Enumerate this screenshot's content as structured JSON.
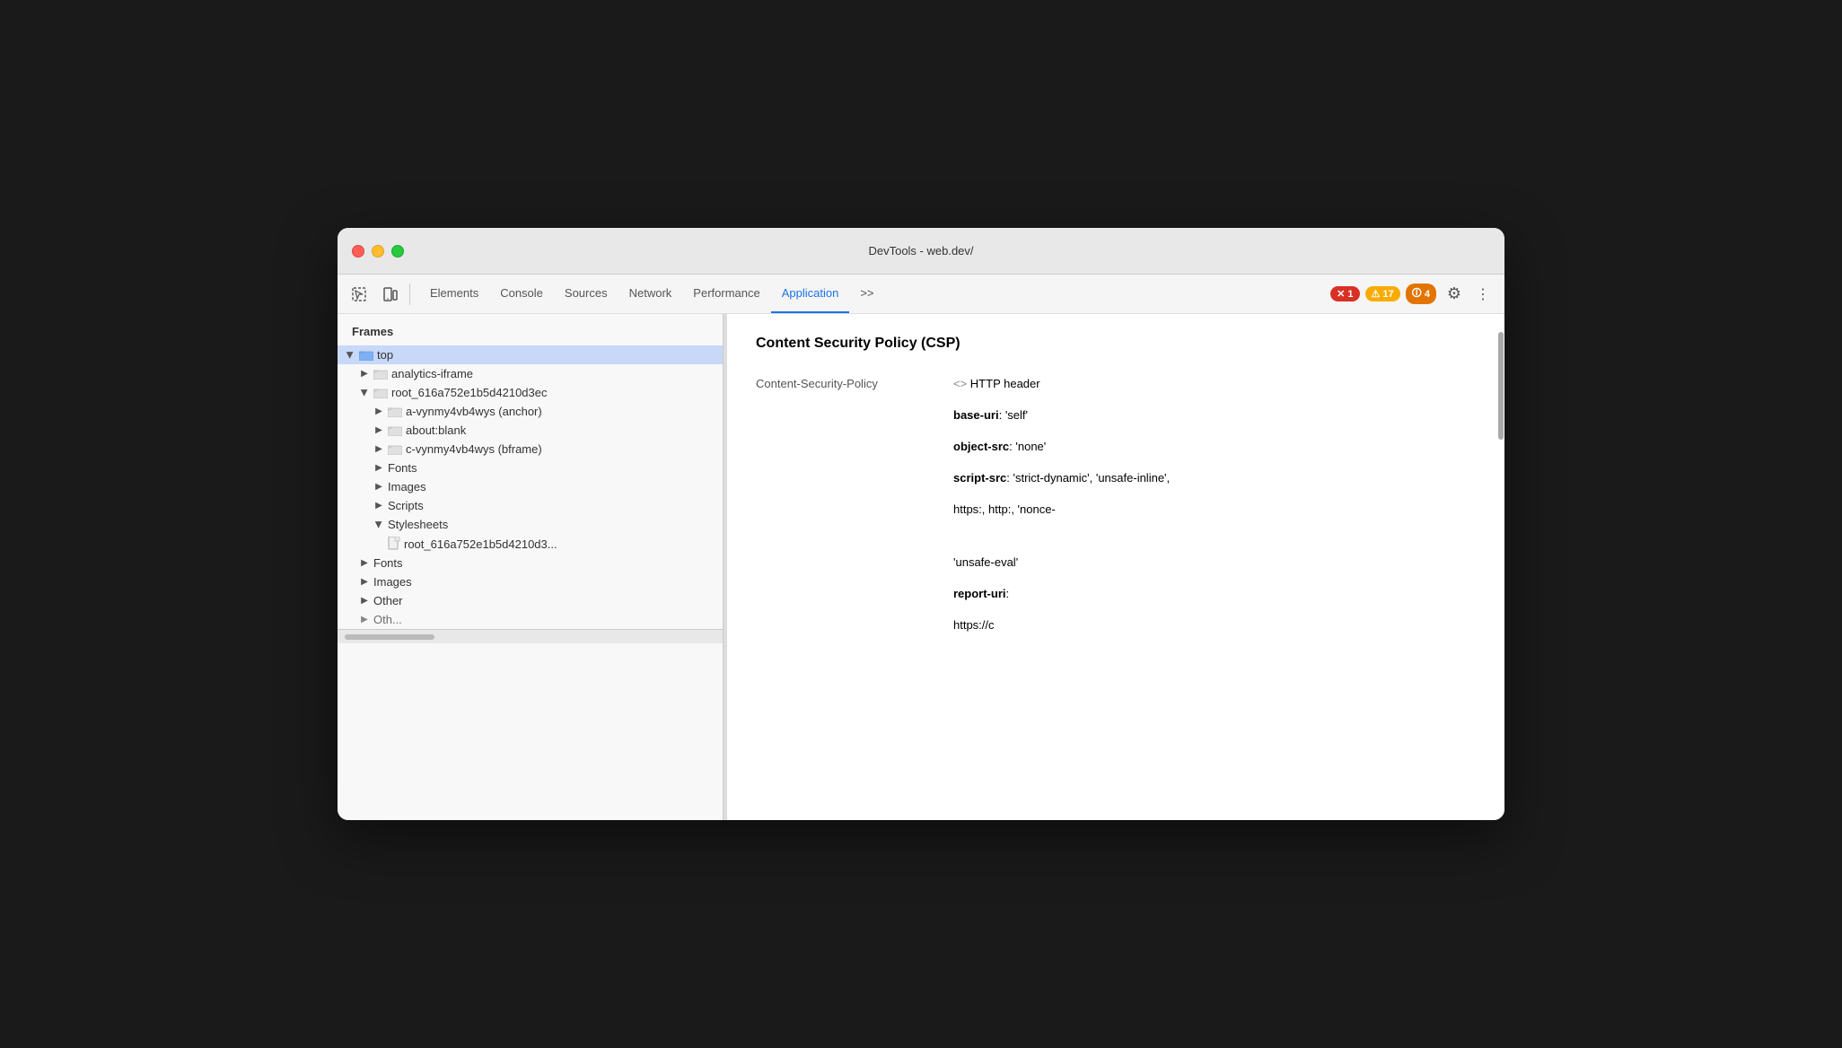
{
  "window": {
    "title": "DevTools - web.dev/"
  },
  "toolbar": {
    "inspect_label": "Inspect",
    "device_label": "Device",
    "tabs": [
      {
        "id": "elements",
        "label": "Elements",
        "active": false
      },
      {
        "id": "console",
        "label": "Console",
        "active": false
      },
      {
        "id": "sources",
        "label": "Sources",
        "active": false
      },
      {
        "id": "network",
        "label": "Network",
        "active": false
      },
      {
        "id": "performance",
        "label": "Performance",
        "active": false
      },
      {
        "id": "application",
        "label": "Application",
        "active": true
      }
    ],
    "more_tabs_label": ">>",
    "error_count": "1",
    "warning_count": "17",
    "info_count": "4"
  },
  "sidebar": {
    "header": "Frames",
    "items": [
      {
        "id": "top",
        "label": "top",
        "level": 0,
        "type": "folder",
        "expanded": true,
        "selected": true,
        "triangle": true
      },
      {
        "id": "analytics-iframe",
        "label": "analytics-iframe",
        "level": 1,
        "type": "folder",
        "expanded": false,
        "triangle": true
      },
      {
        "id": "root-frame",
        "label": "root_616a752e1b5d4210d3ec",
        "level": 1,
        "type": "folder",
        "expanded": true,
        "triangle": true
      },
      {
        "id": "a-vynmy",
        "label": "a-vynmy4vb4wys (anchor)",
        "level": 2,
        "type": "folder",
        "expanded": false,
        "triangle": true
      },
      {
        "id": "about-blank",
        "label": "about:blank",
        "level": 2,
        "type": "folder",
        "expanded": false,
        "triangle": true
      },
      {
        "id": "c-vynmy",
        "label": "c-vynmy4vb4wys (bframe)",
        "level": 2,
        "type": "folder",
        "expanded": false,
        "triangle": true
      },
      {
        "id": "fonts-inner",
        "label": "Fonts",
        "level": 2,
        "type": "folder",
        "expanded": false,
        "triangle": true
      },
      {
        "id": "images-inner",
        "label": "Images",
        "level": 2,
        "type": "folder",
        "expanded": false,
        "triangle": true
      },
      {
        "id": "scripts-inner",
        "label": "Scripts",
        "level": 2,
        "type": "folder",
        "expanded": false,
        "triangle": true
      },
      {
        "id": "stylesheets-inner",
        "label": "Stylesheets",
        "level": 2,
        "type": "folder",
        "expanded": true,
        "triangle": true
      },
      {
        "id": "root-file",
        "label": "root_616a752e1b5d4210d3...",
        "level": 3,
        "type": "file",
        "triangle": false
      },
      {
        "id": "fonts-outer",
        "label": "Fonts",
        "level": 1,
        "type": "folder",
        "expanded": false,
        "triangle": true
      },
      {
        "id": "images-outer",
        "label": "Images",
        "level": 1,
        "type": "folder",
        "expanded": false,
        "triangle": true
      },
      {
        "id": "other-outer",
        "label": "Other",
        "level": 1,
        "type": "folder",
        "expanded": false,
        "triangle": true
      },
      {
        "id": "other2",
        "label": "Oth...",
        "level": 1,
        "type": "folder",
        "expanded": false,
        "triangle": true
      }
    ]
  },
  "content": {
    "title": "Content Security Policy (CSP)",
    "label": "Content-Security-Policy",
    "http_header": "<> HTTP header",
    "base_uri_key": "base-uri",
    "base_uri_val": "'self'",
    "object_src_key": "object-src",
    "object_src_val": "'none'",
    "script_src_key": "script-src",
    "script_src_val": "'strict-dynamic', 'unsafe-inline',",
    "https_line": "https:, http:, 'nonce-",
    "unsafe_eval": "'unsafe-eval'",
    "report_uri_key": "report-uri",
    "report_uri_val": "https://c"
  },
  "icons": {
    "triangle_closed": "▶",
    "triangle_open": "▶",
    "gear": "⚙",
    "more": "⋮",
    "error": "✕",
    "warning": "⚠",
    "info": "ℹ"
  }
}
